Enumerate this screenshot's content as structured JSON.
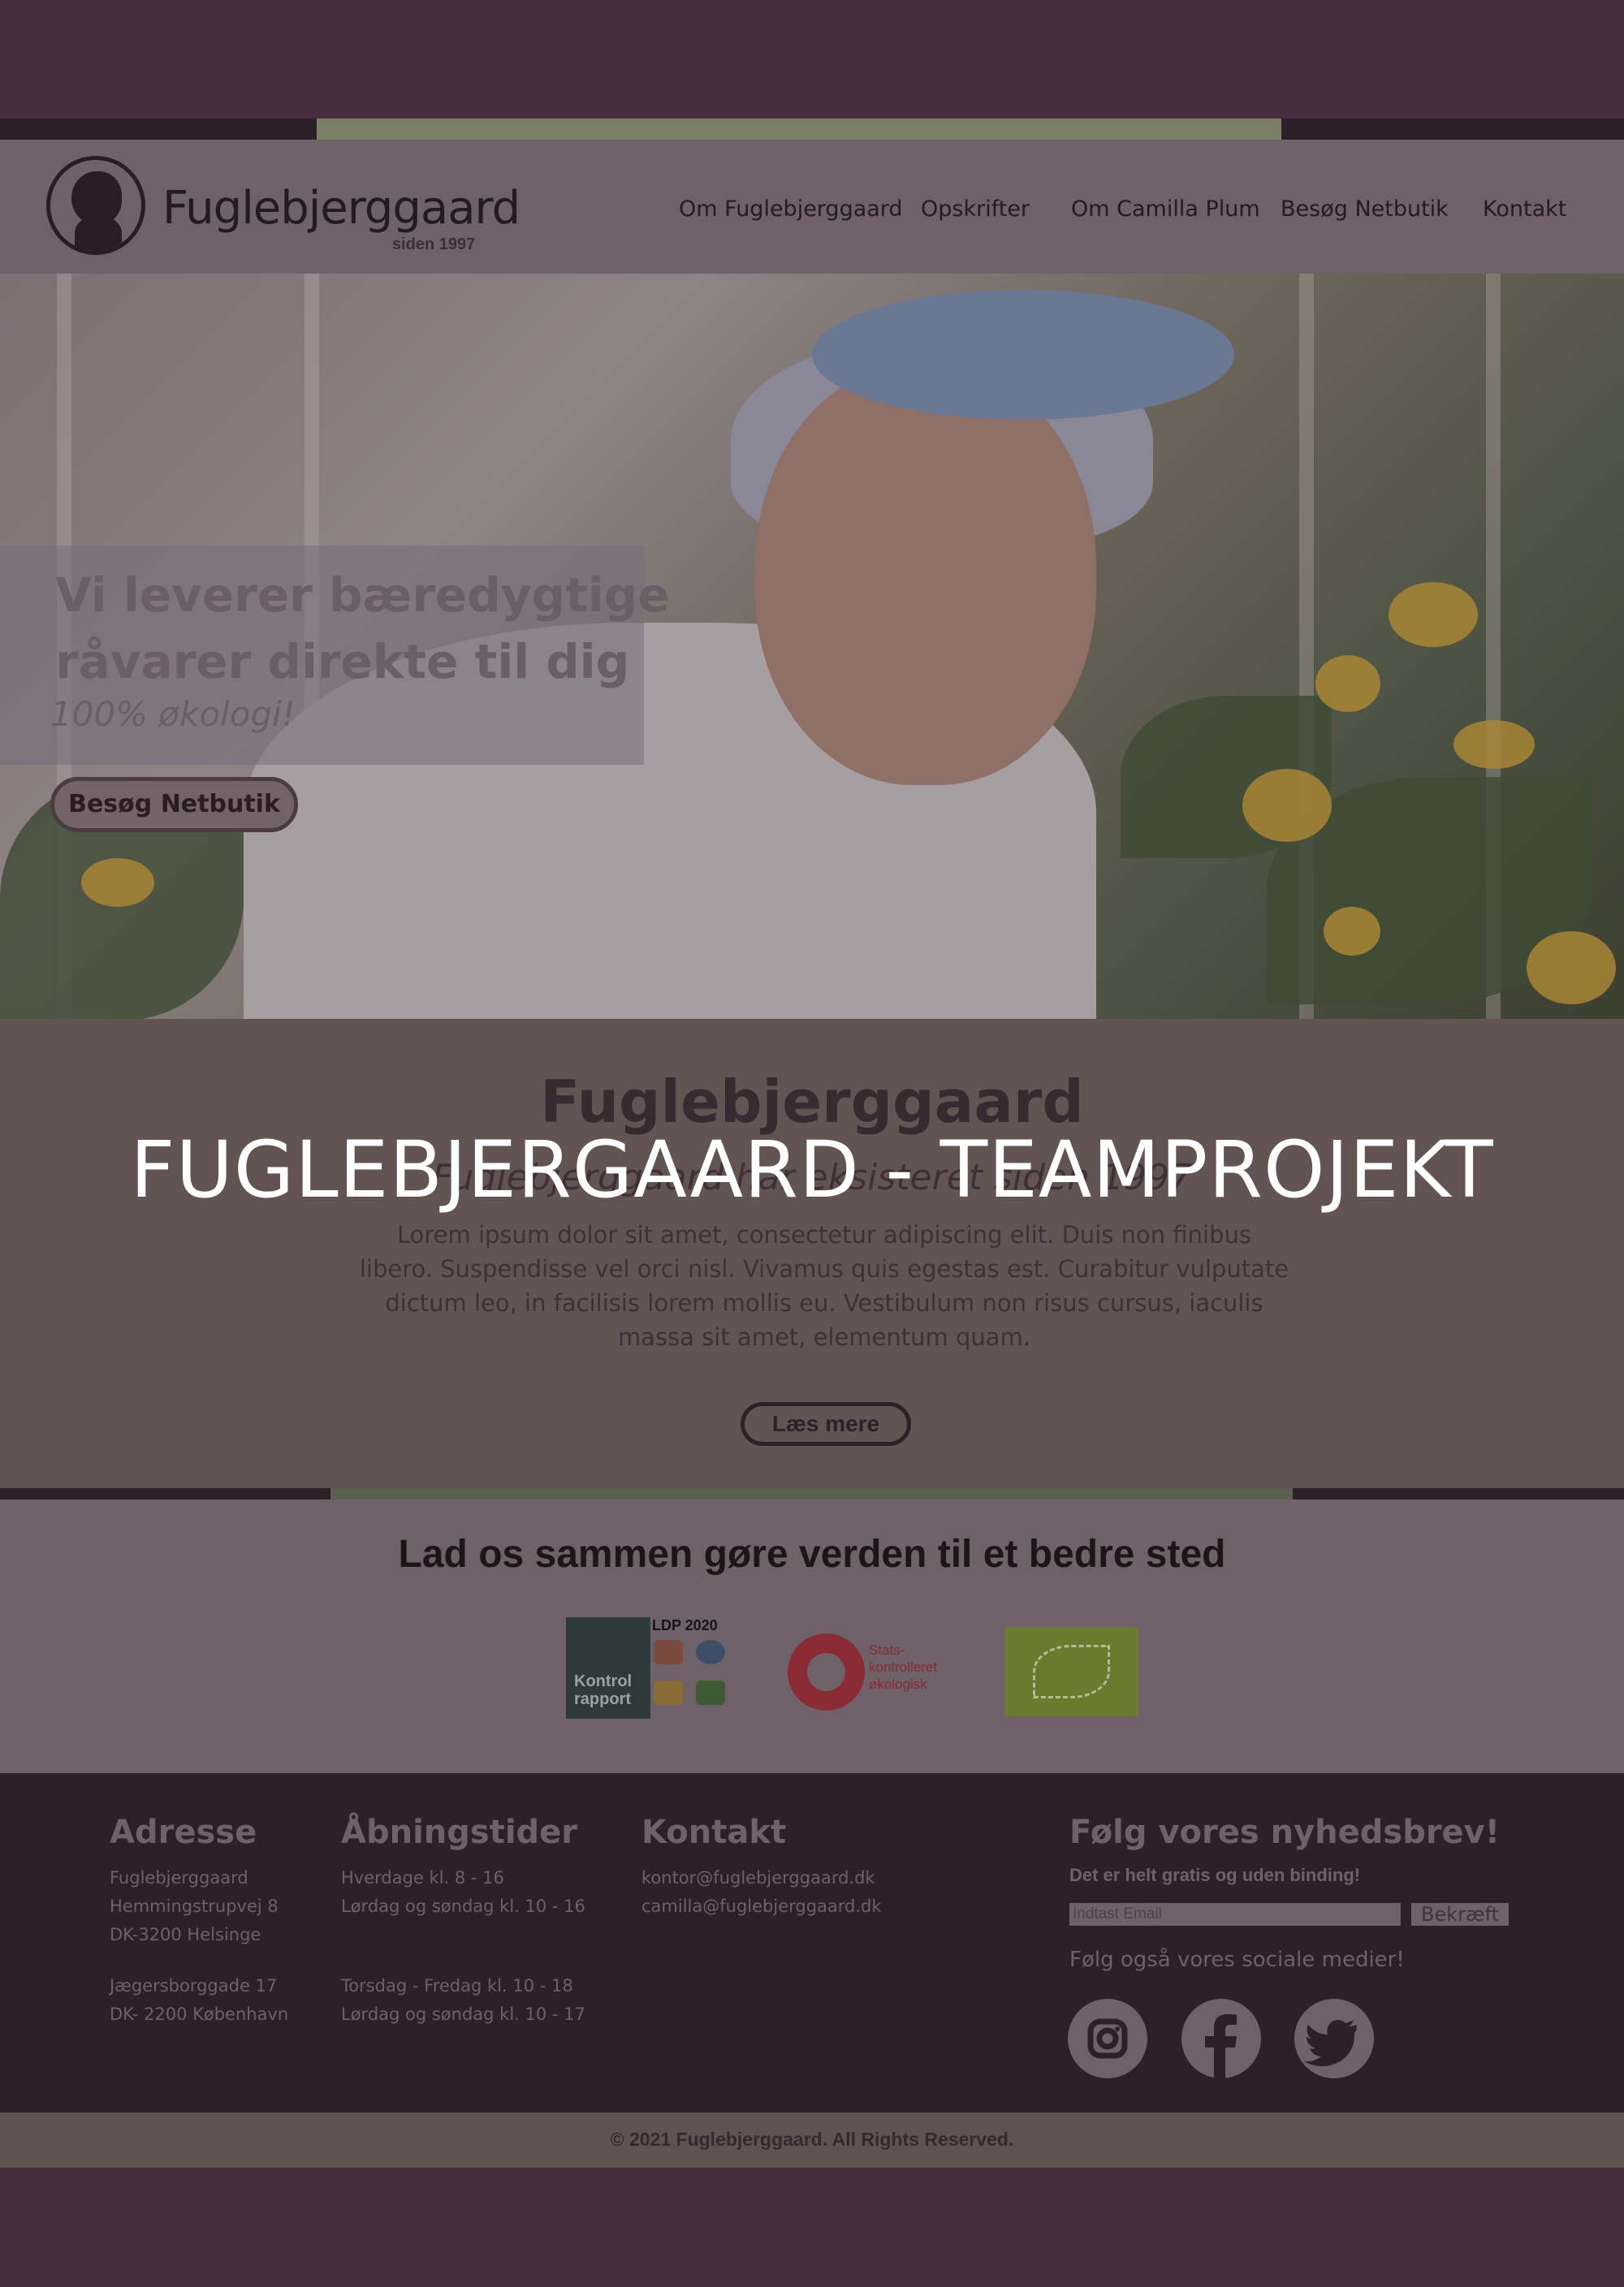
{
  "overlay": {
    "title": "FUGLEBJERGAARD - TEAMPROJEKT"
  },
  "header": {
    "logo_text": "Fuglebjerggaard",
    "logo_sub": "siden 1997",
    "nav": [
      "Om Fuglebjerggaard",
      "Opskrifter",
      "Om Camilla Plum",
      "Besøg Netbutik",
      "Kontakt"
    ]
  },
  "hero": {
    "title": "Vi leverer bæredygtige råvarer direkte til dig",
    "tagline": "100% økologi!",
    "button": "Besøg Netbutik"
  },
  "intro": {
    "title": "Fuglebjerggaard",
    "subtitle": "Fuglebjerggaard har eksisteret siden 1997",
    "body": "Lorem ipsum dolor sit amet, consectetur adipiscing elit. Duis non finibus libero. Suspendisse vel orci nisl. Vivamus quis egestas est. Curabitur vulputate dictum leo, in facilisis lorem mollis eu. Vestibulum non risus cursus, iaculis massa sit amet, elementum quam.",
    "button": "Læs mere"
  },
  "certifications": {
    "title": "Lad os sammen gøre verden til et bedre sted",
    "ldp_label": "LDP 2020",
    "kontrol_label": "Kontrol rapport",
    "stats_label": "Stats- kontrolleret økologisk"
  },
  "footer": {
    "address": {
      "heading": "Adresse",
      "lines1": [
        "Fuglebjerggaard",
        "Hemmingstrupvej 8",
        "DK-3200 Helsinge"
      ],
      "lines2": [
        "Jægersborggade 17",
        "DK- 2200 København"
      ]
    },
    "hours": {
      "heading": "Åbningstider",
      "lines1": [
        "Hverdage kl. 8 - 16",
        "Lørdag og søndag kl. 10 - 16"
      ],
      "lines2": [
        "Torsdag - Fredag kl. 10 - 18",
        "Lørdag og søndag kl. 10 - 17"
      ]
    },
    "contact": {
      "heading": "Kontakt",
      "emails": [
        "kontor@fuglebjerggaard.dk",
        "camilla@fuglebjerggaard.dk"
      ]
    },
    "newsletter": {
      "heading": "Følg vores nyhedsbrev!",
      "subtext": "Det er helt gratis og uden binding!",
      "placeholder": "Indtast Email",
      "button": "Bekræft",
      "social_label": "Følg også vores sociale medier!"
    },
    "social_icons": [
      "instagram-icon",
      "facebook-icon",
      "twitter-icon"
    ],
    "copyright": "© 2021 Fuglebjerggaard. All Rights Reserved."
  },
  "colors": {
    "page_bg": "#472d3f",
    "footer_bg": "#2e2028",
    "accent_green": "#7a7f66",
    "stats_red": "#8a2a35",
    "eu_green": "#6b7a2e"
  }
}
